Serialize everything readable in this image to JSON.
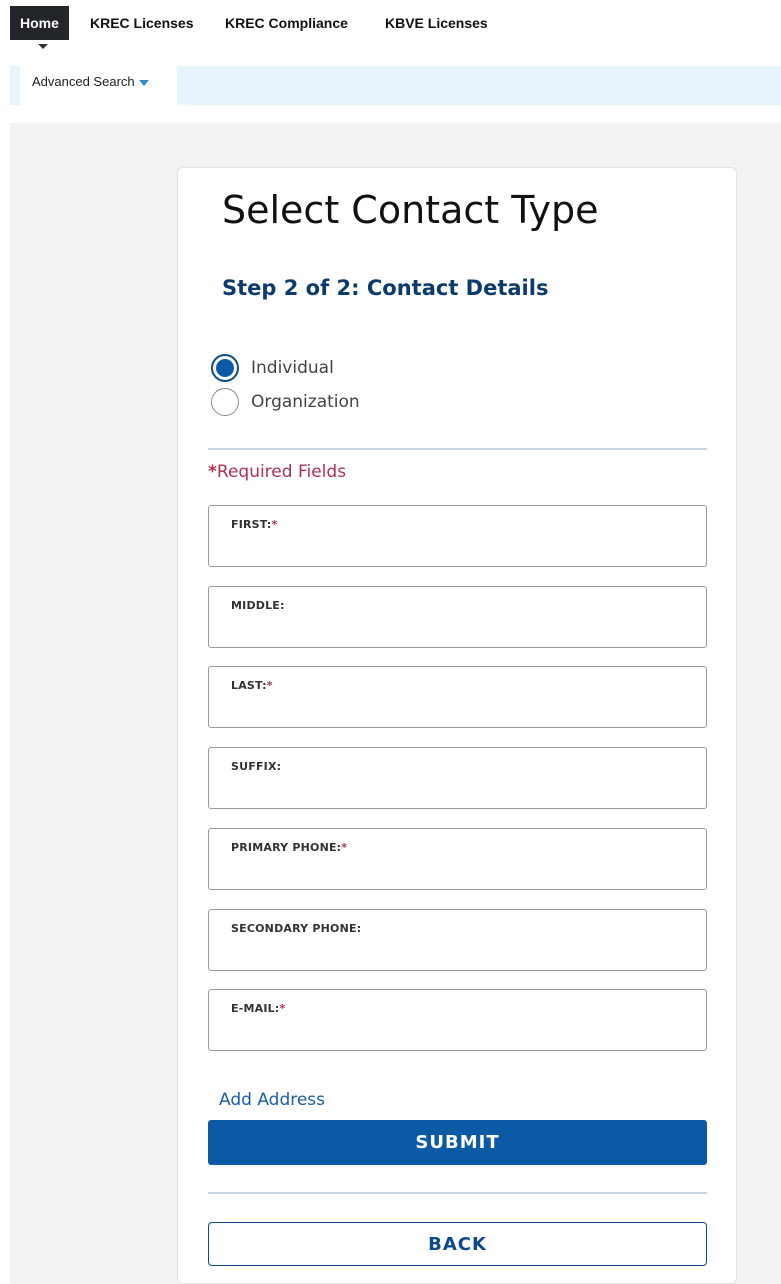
{
  "nav": {
    "items": [
      {
        "label": "Home",
        "active": true
      },
      {
        "label": "KREC Licenses",
        "active": false
      },
      {
        "label": "KREC Compliance",
        "active": false
      },
      {
        "label": "KBVE Licenses",
        "active": false
      }
    ]
  },
  "subnav": {
    "advanced_search": "Advanced Search"
  },
  "page": {
    "title": "Select Contact Type",
    "step": "Step 2 of 2: Contact Details"
  },
  "contact_type": {
    "options": [
      {
        "label": "Individual",
        "selected": true
      },
      {
        "label": "Organization",
        "selected": false
      }
    ]
  },
  "form": {
    "required_note": "Required Fields",
    "required_marker": "*",
    "fields": [
      {
        "label": "FIRST:",
        "required": true,
        "value": ""
      },
      {
        "label": "MIDDLE:",
        "required": false,
        "value": ""
      },
      {
        "label": "LAST:",
        "required": true,
        "value": ""
      },
      {
        "label": "SUFFIX:",
        "required": false,
        "value": ""
      },
      {
        "label": "PRIMARY PHONE:",
        "required": true,
        "value": ""
      },
      {
        "label": "SECONDARY PHONE:",
        "required": false,
        "value": ""
      },
      {
        "label": "E-MAIL:",
        "required": true,
        "value": ""
      }
    ]
  },
  "actions": {
    "add_address": "Add Address",
    "submit": "SUBMIT",
    "back": "BACK"
  },
  "colors": {
    "primary": "#0c5aa6",
    "required": "#b03050",
    "nav_active": "#22252a"
  }
}
